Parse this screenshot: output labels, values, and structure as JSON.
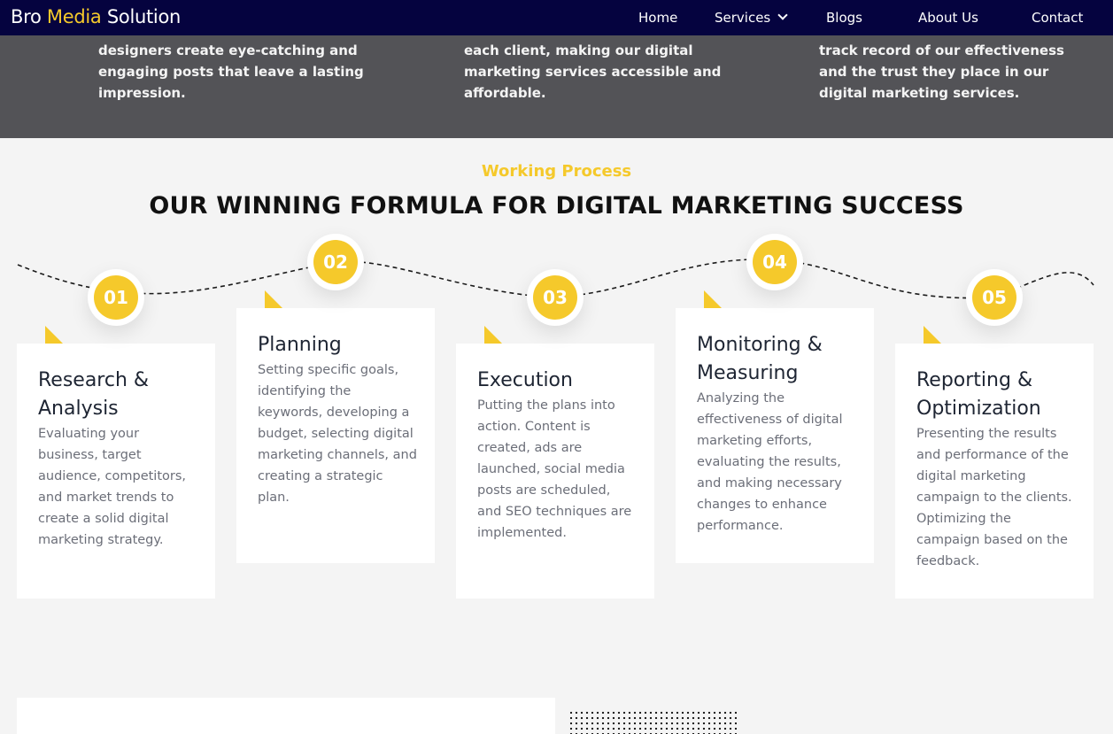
{
  "brand": {
    "part1": "Bro ",
    "part2": "Media",
    "part3": " Solution",
    "accent_color": "#f5c92b",
    "nav_bg": "#05033f"
  },
  "nav": {
    "home": "Home",
    "services": "Services",
    "blogs": "Blogs",
    "about": "About Us",
    "contact": "Contact"
  },
  "features": {
    "col1": "designers create eye-catching and engaging posts that leave a lasting impression.",
    "col2": "each client, making our digital marketing services accessible and affordable.",
    "col3": "track record of our effectiveness and the trust they place in our digital marketing services."
  },
  "process": {
    "eyebrow": "Working Process",
    "heading": "OUR WINNING FORMULA FOR DIGITAL MARKETING SUCCESS",
    "steps": [
      {
        "number": "01",
        "title": "Research & Analysis",
        "text": "Evaluating your business, target audience, competitors, and market trends to create a solid digital marketing strategy."
      },
      {
        "number": "02",
        "title": "Planning",
        "text": "Setting specific goals, identifying the keywords, developing a budget, selecting digital marketing channels, and creating a strategic plan."
      },
      {
        "number": "03",
        "title": "Execution",
        "text": "Putting the plans into action. Content is created, ads are launched, social media posts are scheduled, and SEO techniques are implemented."
      },
      {
        "number": "04",
        "title": "Monitoring & Measuring",
        "text": "Analyzing the effectiveness of digital marketing efforts, evaluating the results, and making necessary changes to enhance performance."
      },
      {
        "number": "05",
        "title": "Reporting & Optimization",
        "text": "Presenting the results and performance of the digital marketing campaign to the clients. Optimizing the campaign based on the feedback."
      }
    ]
  }
}
